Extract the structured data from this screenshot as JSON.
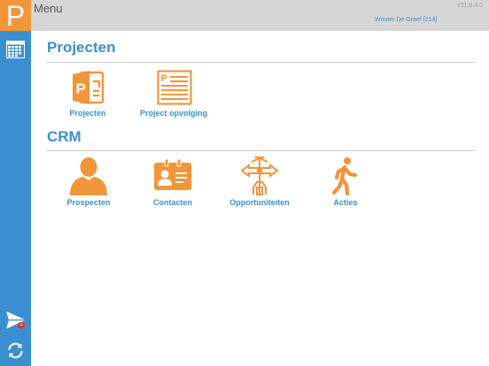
{
  "header": {
    "logo_letter": "P",
    "menu_title": "Menu",
    "version": "v21.8.4.0",
    "user": "Wouter De Graef [214]"
  },
  "sidebar": {
    "items": [
      {
        "icon": "calendar-icon"
      },
      {
        "icon": "send-icon",
        "badge": "4"
      },
      {
        "icon": "sync-icon"
      }
    ]
  },
  "sections": [
    {
      "title": "Projecten",
      "tiles": [
        {
          "label": "Projecten",
          "icon": "powerpoint-icon"
        },
        {
          "label": "Project opvolging",
          "icon": "project-list-icon"
        }
      ]
    },
    {
      "title": "CRM",
      "tiles": [
        {
          "label": "Prospecten",
          "icon": "person-icon"
        },
        {
          "label": "Contacten",
          "icon": "contact-card-icon"
        },
        {
          "label": "Opportuniteiten",
          "icon": "signpost-icon"
        },
        {
          "label": "Acties",
          "icon": "walking-person-icon"
        }
      ]
    }
  ],
  "colors": {
    "accent_orange": "#f2953b",
    "sidebar_blue": "#3b8fd0",
    "topbar_gray": "#d6d6d6"
  }
}
